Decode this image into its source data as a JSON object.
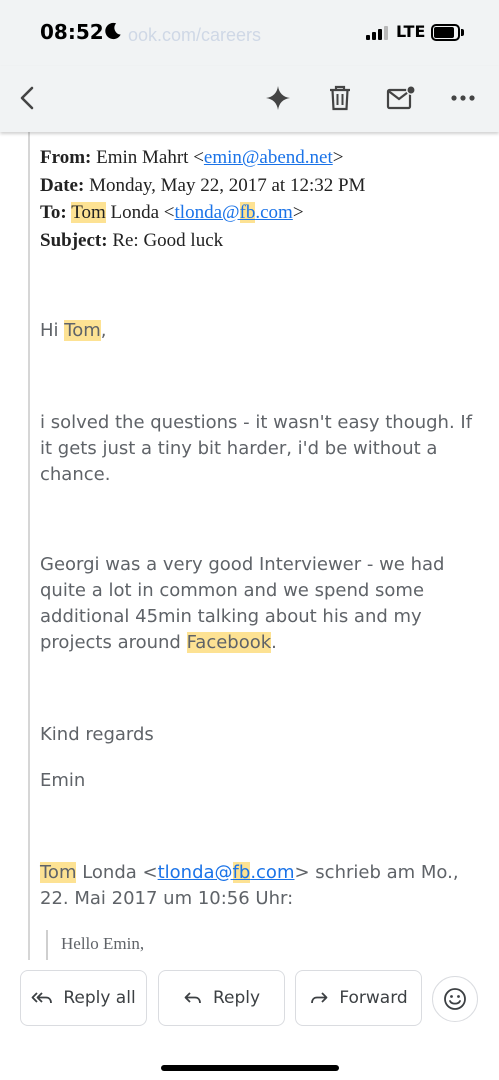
{
  "status": {
    "time": "08:52",
    "network": "LTE",
    "battery_level": 0.85,
    "url_ghost": "ook.com/careers"
  },
  "toolbar": {
    "back_icon": "chevron-left-icon",
    "gemini_icon": "sparkle-icon",
    "delete_icon": "trash-icon",
    "mark_unread_icon": "mail-unread-icon",
    "more_icon": "more-horizontal-icon"
  },
  "email": {
    "from_label": "From:",
    "from_name": "Emin Mahrt <",
    "from_email": "emin@abend.net",
    "from_close": ">",
    "date_label": "Date:",
    "date_value": "Monday, May 22, 2017 at 12:32 PM",
    "to_label": "To:",
    "to_highlight": "Tom",
    "to_name_rest": " Londa <",
    "to_email_part1": "tlonda@",
    "to_email_highlight": "fb",
    "to_email_part3": ".com",
    "to_close": ">",
    "subject_label": "Subject:",
    "subject_value": "Re: Good luck",
    "greeting_prefix": "Hi ",
    "greeting_name": "Tom",
    "greeting_suffix": ",",
    "paragraph1": "i solved the questions - it wasn't easy though. If it gets just a tiny bit harder, i'd be without a chance.",
    "paragraph2_text": "Georgi was a very good Interviewer - we had quite a lot in common and we spend some additional 45min talking about his and my projects around ",
    "paragraph2_highlight": "Facebook",
    "paragraph2_end": ".",
    "closing": "Kind regards",
    "signature": "Emin",
    "quote_header_name": "Tom",
    "quote_header_rest": " Londa <",
    "quote_email_part1": "tlonda@",
    "quote_email_highlight": "fb",
    "quote_email_part3": ".com",
    "quote_header_after": "> schrieb am Mo., 22. Mai 2017 um 10:56 Uhr:",
    "quoted_text": "Hello Emin,"
  },
  "actions": {
    "reply_all_label": "Reply all",
    "reply_label": "Reply",
    "forward_label": "Forward",
    "emoji_icon": "emoji-reaction-icon"
  },
  "colors": {
    "toolbar_bg": "#f1f3f4",
    "highlight": "#fde293",
    "link": "#1a73e8",
    "body_text": "#5f6368"
  }
}
